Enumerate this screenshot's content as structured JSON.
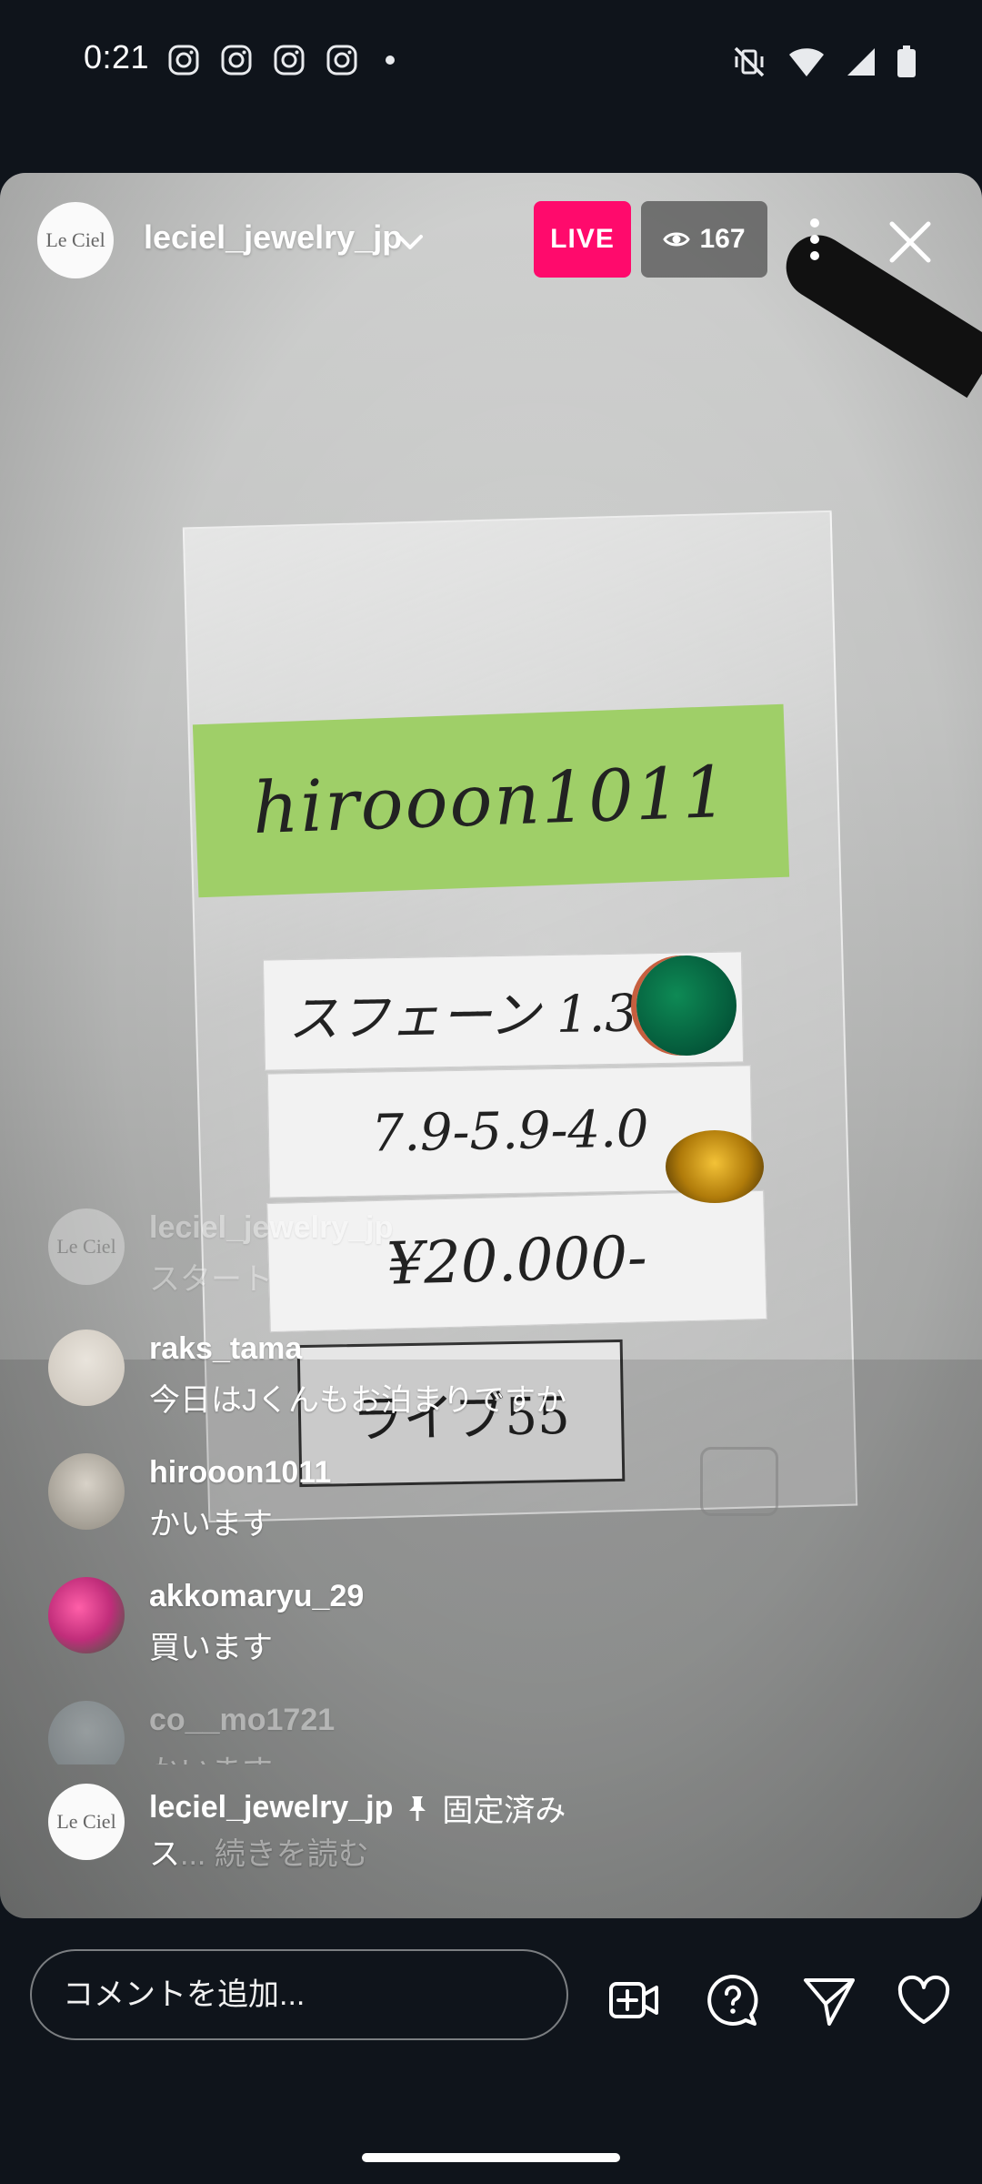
{
  "status_bar": {
    "time": "0:21"
  },
  "header": {
    "avatar_text": "Le Ciel",
    "username": "leciel_jewelry_jp",
    "live_label": "LIVE",
    "viewer_count": "167"
  },
  "stream_scene": {
    "label_text": "hirooon1011",
    "card1_text": "スフェーン 1.39ct",
    "card2_text": "7.9-5.9-4.0",
    "card3_text": "¥20.000-",
    "card4_text": "ライブ55"
  },
  "comments": [
    {
      "username": "leciel_jewelry_jp",
      "text": "スタート",
      "avatar_text": "Le Ciel"
    },
    {
      "username": "raks_tama",
      "text": "今日はJくんもお泊まりですか"
    },
    {
      "username": "hirooon1011",
      "text": "かいます"
    },
    {
      "username": "akkomaryu_29",
      "text": "買います"
    },
    {
      "username": "co__mo1721",
      "text": "かいます"
    }
  ],
  "pinned": {
    "username": "leciel_jewelry_jp",
    "pinned_label": "固定済み",
    "text": "ス",
    "read_more": "... 続きを読む",
    "avatar_text": "Le Ciel"
  },
  "bottom_bar": {
    "comment_placeholder": "コメントを追加..."
  }
}
